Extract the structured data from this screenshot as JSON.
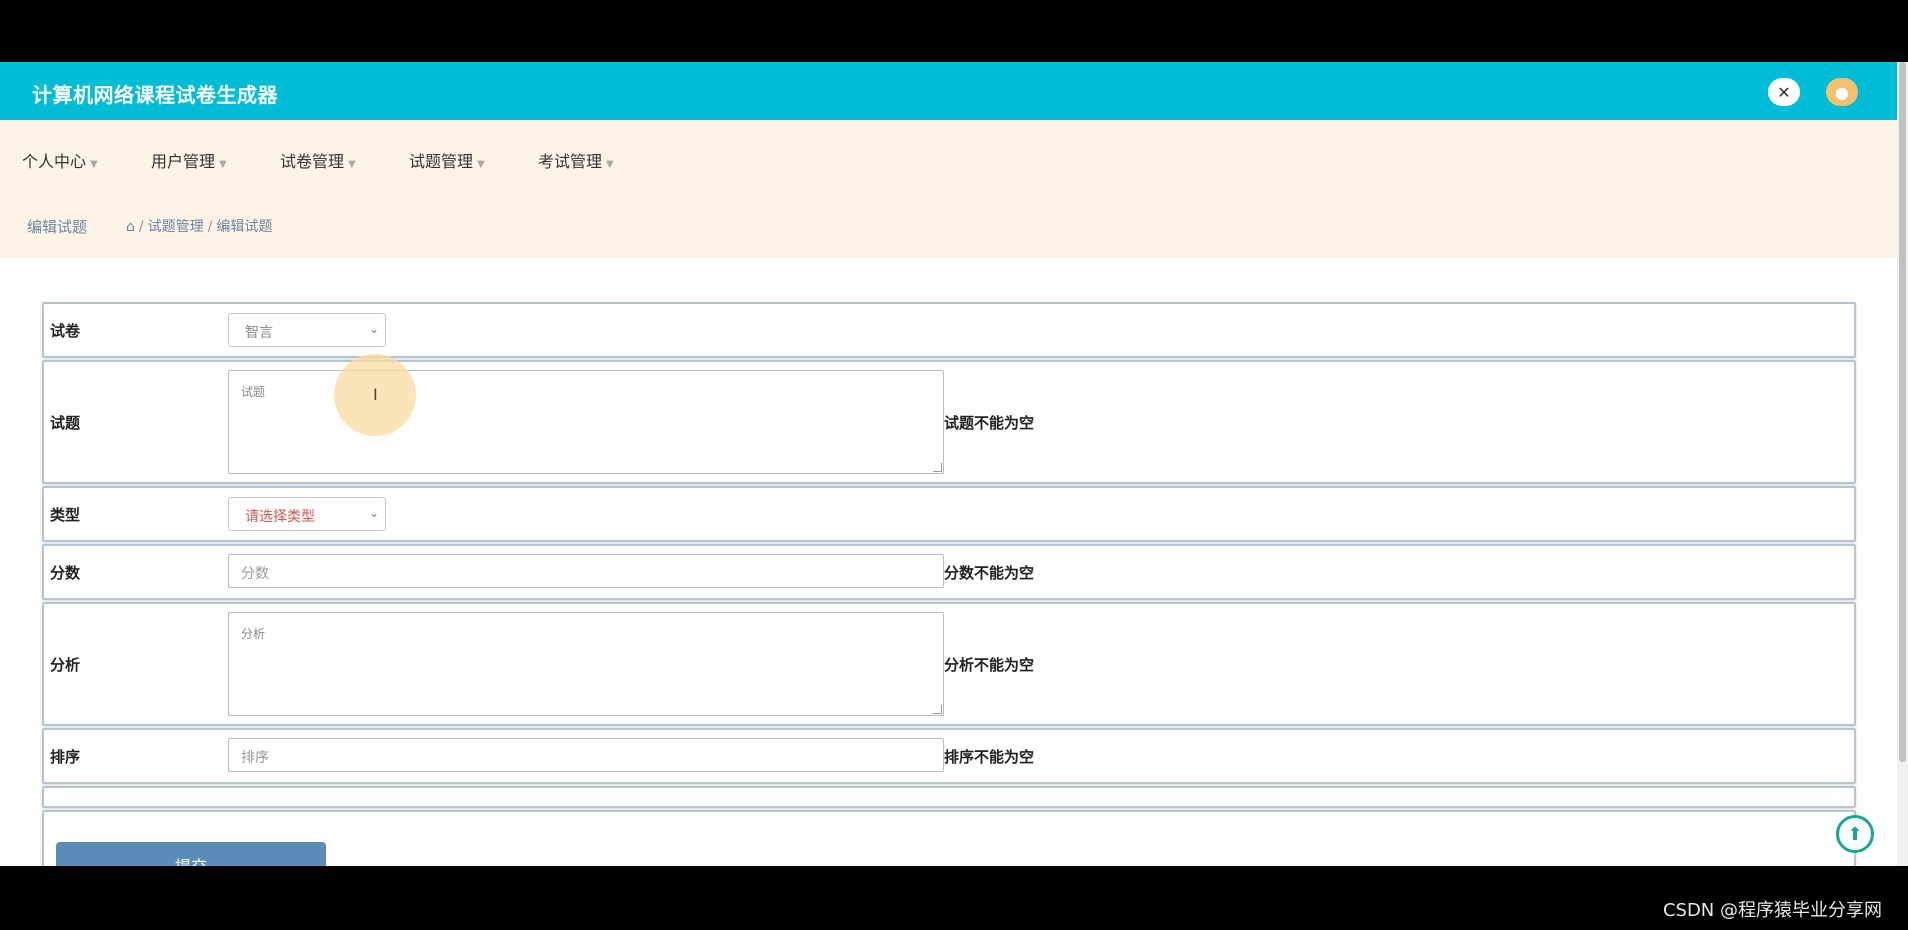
{
  "header": {
    "title": "计算机网络课程试卷生成器"
  },
  "nav": {
    "items": [
      {
        "label": "个人中心"
      },
      {
        "label": "用户管理"
      },
      {
        "label": "试卷管理"
      },
      {
        "label": "试题管理"
      },
      {
        "label": "考试管理"
      }
    ]
  },
  "breadcrumb": {
    "page_title": "编辑试题",
    "path": [
      "试题管理",
      "编辑试题"
    ]
  },
  "form": {
    "paper": {
      "label": "试卷",
      "value": "智言"
    },
    "question": {
      "label": "试题",
      "placeholder": "试题",
      "hint": "试题不能为空"
    },
    "type": {
      "label": "类型",
      "value": "请选择类型"
    },
    "score": {
      "label": "分数",
      "placeholder": "分数",
      "hint": "分数不能为空"
    },
    "analysis": {
      "label": "分析",
      "placeholder": "分析",
      "hint": "分析不能为空"
    },
    "order": {
      "label": "排序",
      "placeholder": "排序",
      "hint": "排序不能为空"
    },
    "submit_label": "提交"
  },
  "icons": {
    "fullscreen": "fullscreen-icon",
    "avatar": "user-avatar-icon",
    "home": "home-icon",
    "scroll_top": "arrow-up-icon"
  },
  "colors": {
    "header_bg": "#00bcd4",
    "nav_bg": "#fdf3e6",
    "submit_bg": "#5b8db8",
    "type_select_text": "#d9534f"
  },
  "footer": {
    "watermark": "CSDN @程序猿毕业分享网"
  }
}
